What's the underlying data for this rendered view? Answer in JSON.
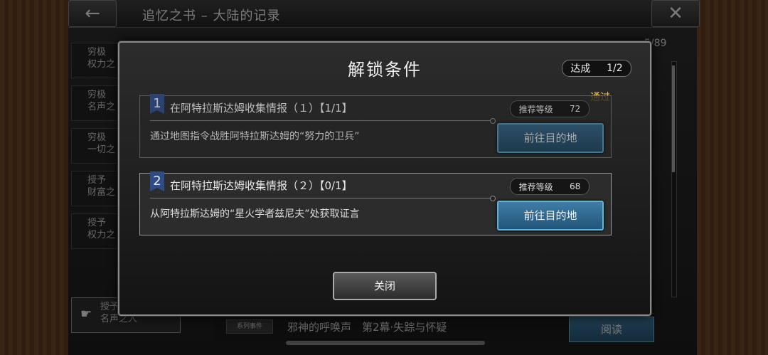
{
  "header": {
    "title": "追忆之书 – 大陆的记录",
    "back_icon": "←",
    "close_icon": "✕",
    "counter": "5/89"
  },
  "sidebar": {
    "items": [
      {
        "label": "穷极\n权力之"
      },
      {
        "label": "穷极\n名声之"
      },
      {
        "label": "穷极\n一切之"
      },
      {
        "label": "授予\n财富之"
      },
      {
        "label": "授予\n权力之"
      }
    ],
    "active_label": "授予\n名声之人",
    "hand_icon": "☛"
  },
  "background_list": {
    "bottom_row": {
      "tag": "系列事件",
      "text": "邪神的呼唤声　第2幕·失踪与怀疑",
      "button": "阅读"
    }
  },
  "modal": {
    "title": "解锁条件",
    "progress_label": "达成",
    "progress_value": "1/2",
    "pass_label": "通过",
    "conditions": [
      {
        "number": "1",
        "title": "在阿特拉斯达姆收集情报（１）【1/1】",
        "description": "通过地图指令战胜阿特拉斯达姆的“努力的卫兵”",
        "level_label": "推荐等级",
        "level_value": "72",
        "button": "前往目的地"
      },
      {
        "number": "2",
        "title": "在阿特拉斯达姆收集情报（２）【0/1】",
        "description": "从阿特拉斯达姆的“星火学者兹尼夫”处获取证言",
        "level_label": "推荐等级",
        "level_value": "68",
        "button": "前往目的地"
      }
    ],
    "close_button": "关闭"
  },
  "colors": {
    "accent_blue": "#3f7da6",
    "pass_gold": "#f2c94c",
    "flag_blue": "#2e4c86"
  }
}
